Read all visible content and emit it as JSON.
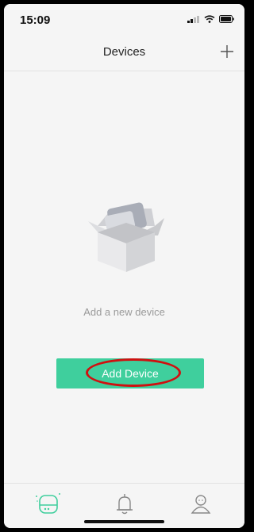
{
  "status_bar": {
    "time": "15:09"
  },
  "header": {
    "title": "Devices"
  },
  "empty_state": {
    "message": "Add a new device"
  },
  "actions": {
    "add_device_label": "Add Device"
  },
  "tabs": [
    {
      "name": "devices",
      "icon": "device-icon",
      "active": true
    },
    {
      "name": "notifications",
      "icon": "bell-icon",
      "active": false
    },
    {
      "name": "profile",
      "icon": "user-icon",
      "active": false
    }
  ],
  "colors": {
    "accent": "#3fcf9d",
    "highlight": "#d01010",
    "background": "#f5f5f5"
  }
}
